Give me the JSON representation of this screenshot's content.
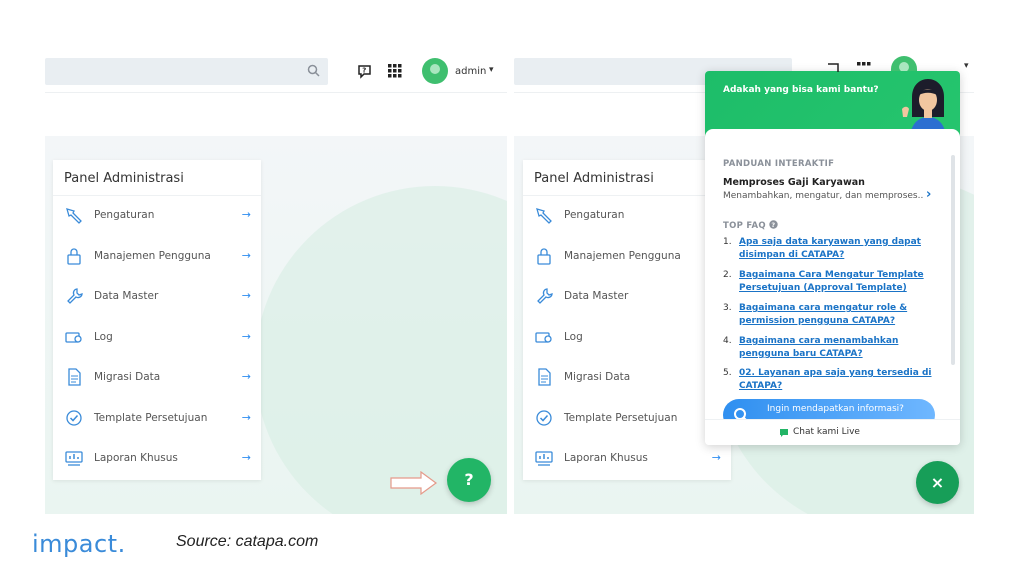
{
  "header": {
    "username": "admin"
  },
  "panel": {
    "title": "Panel Administrasi",
    "items": [
      {
        "label": "Pengaturan",
        "icon": "tools-icon"
      },
      {
        "label": "Manajemen Pengguna",
        "icon": "lock-icon"
      },
      {
        "label": "Data Master",
        "icon": "wrench-icon"
      },
      {
        "label": "Log",
        "icon": "log-icon"
      },
      {
        "label": "Migrasi Data",
        "icon": "document-icon"
      },
      {
        "label": "Template Persetujuan",
        "icon": "check-badge-icon"
      },
      {
        "label": "Laporan Khusus",
        "icon": "report-icon"
      }
    ]
  },
  "help_button": {
    "label": "?"
  },
  "close_button": {
    "label": "×"
  },
  "chat": {
    "greeting": "Adakah yang bisa kami bantu?",
    "guide_section": "PANDUAN INTERAKTIF",
    "guide_title": "Memproses Gaji Karyawan",
    "guide_desc": "Menambahkan, mengatur, dan memproses...",
    "faq_section": "TOP FAQ",
    "faq": [
      {
        "num": "1.",
        "text": "Apa saja data karyawan yang dapat disimpan di CATAPA?"
      },
      {
        "num": "2.",
        "text": "Bagaimana Cara Mengatur Template Persetujuan (Approval Template)"
      },
      {
        "num": "3.",
        "text": "Bagaimana cara mengatur role & permission pengguna CATAPA?"
      },
      {
        "num": "4.",
        "text": "Bagaimana cara menambahkan pengguna baru CATAPA?"
      },
      {
        "num": "5.",
        "text": "02. Layanan apa saja yang tersedia di CATAPA?"
      }
    ],
    "search_prompt": "Ingin mendapatkan informasi?",
    "live_chat": "Chat kami Live"
  },
  "footer": {
    "logo": "impact.",
    "source": "Source: catapa.com"
  },
  "colors": {
    "accent_green": "#22b566",
    "link_blue": "#1a73c6",
    "arrow_blue": "#2d8cf0",
    "logo_blue": "#3a8bd9"
  }
}
